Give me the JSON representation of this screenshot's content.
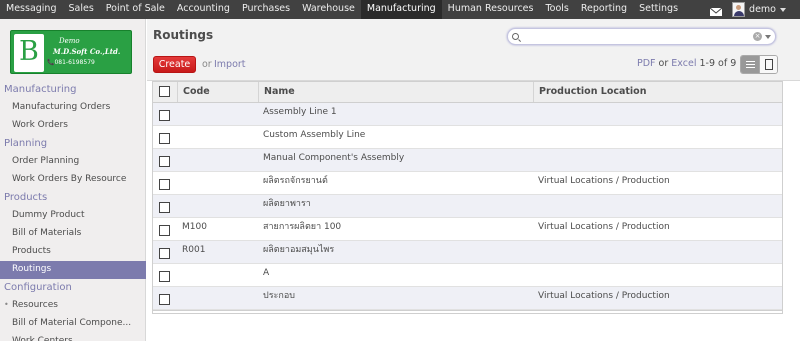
{
  "topmenu": [
    {
      "label": "Messaging",
      "active": false
    },
    {
      "label": "Sales",
      "active": false
    },
    {
      "label": "Point of Sale",
      "active": false
    },
    {
      "label": "Accounting",
      "active": false
    },
    {
      "label": "Purchases",
      "active": false
    },
    {
      "label": "Warehouse",
      "active": false
    },
    {
      "label": "Manufacturing",
      "active": true
    },
    {
      "label": "Human Resources",
      "active": false
    },
    {
      "label": "Tools",
      "active": false
    },
    {
      "label": "Reporting",
      "active": false
    },
    {
      "label": "Settings",
      "active": false
    }
  ],
  "user": {
    "name": "demo"
  },
  "logo": {
    "letter": "B",
    "line1": "Demo",
    "line2": "M.D.Soft Co.,Ltd.",
    "line3": "081-6198579"
  },
  "sidebar": {
    "sections": [
      {
        "heading": "Manufacturing",
        "items": [
          "Manufacturing Orders",
          "Work Orders"
        ]
      },
      {
        "heading": "Planning",
        "items": [
          "Order Planning",
          "Work Orders By Resource"
        ]
      },
      {
        "heading": "Products",
        "items": [
          "Dummy Product",
          "Bill of Materials",
          "Products",
          "Routings"
        ]
      },
      {
        "heading": "Configuration",
        "items": [
          "Resources",
          "Bill of Material Compone...",
          "Work Centers"
        ]
      }
    ],
    "active_item": "Routings"
  },
  "page": {
    "title": "Routings",
    "create_label": "Create",
    "or_label": "or",
    "import_label": "Import",
    "pdf_label": "PDF",
    "or2_label": "or",
    "excel_label": "Excel",
    "pager": "1-9 of 9",
    "search_placeholder": ""
  },
  "table": {
    "columns": [
      "Code",
      "Name",
      "Production Location"
    ],
    "rows": [
      {
        "code": "",
        "name": "Assembly Line 1",
        "location": ""
      },
      {
        "code": "",
        "name": "Custom Assembly Line",
        "location": ""
      },
      {
        "code": "",
        "name": "Manual Component's Assembly",
        "location": ""
      },
      {
        "code": "",
        "name": "ผลิตรถจักรยานต์",
        "location": "Virtual Locations / Production"
      },
      {
        "code": "",
        "name": "ผลิตยาพารา",
        "location": ""
      },
      {
        "code": "M100",
        "name": "สายการผลิตยา 100",
        "location": "Virtual Locations / Production"
      },
      {
        "code": "R001",
        "name": "ผลิตยาอมสมุนไพร",
        "location": ""
      },
      {
        "code": "",
        "name": "A",
        "location": ""
      },
      {
        "code": "",
        "name": "ประกอบ",
        "location": "Virtual Locations / Production"
      }
    ]
  }
}
